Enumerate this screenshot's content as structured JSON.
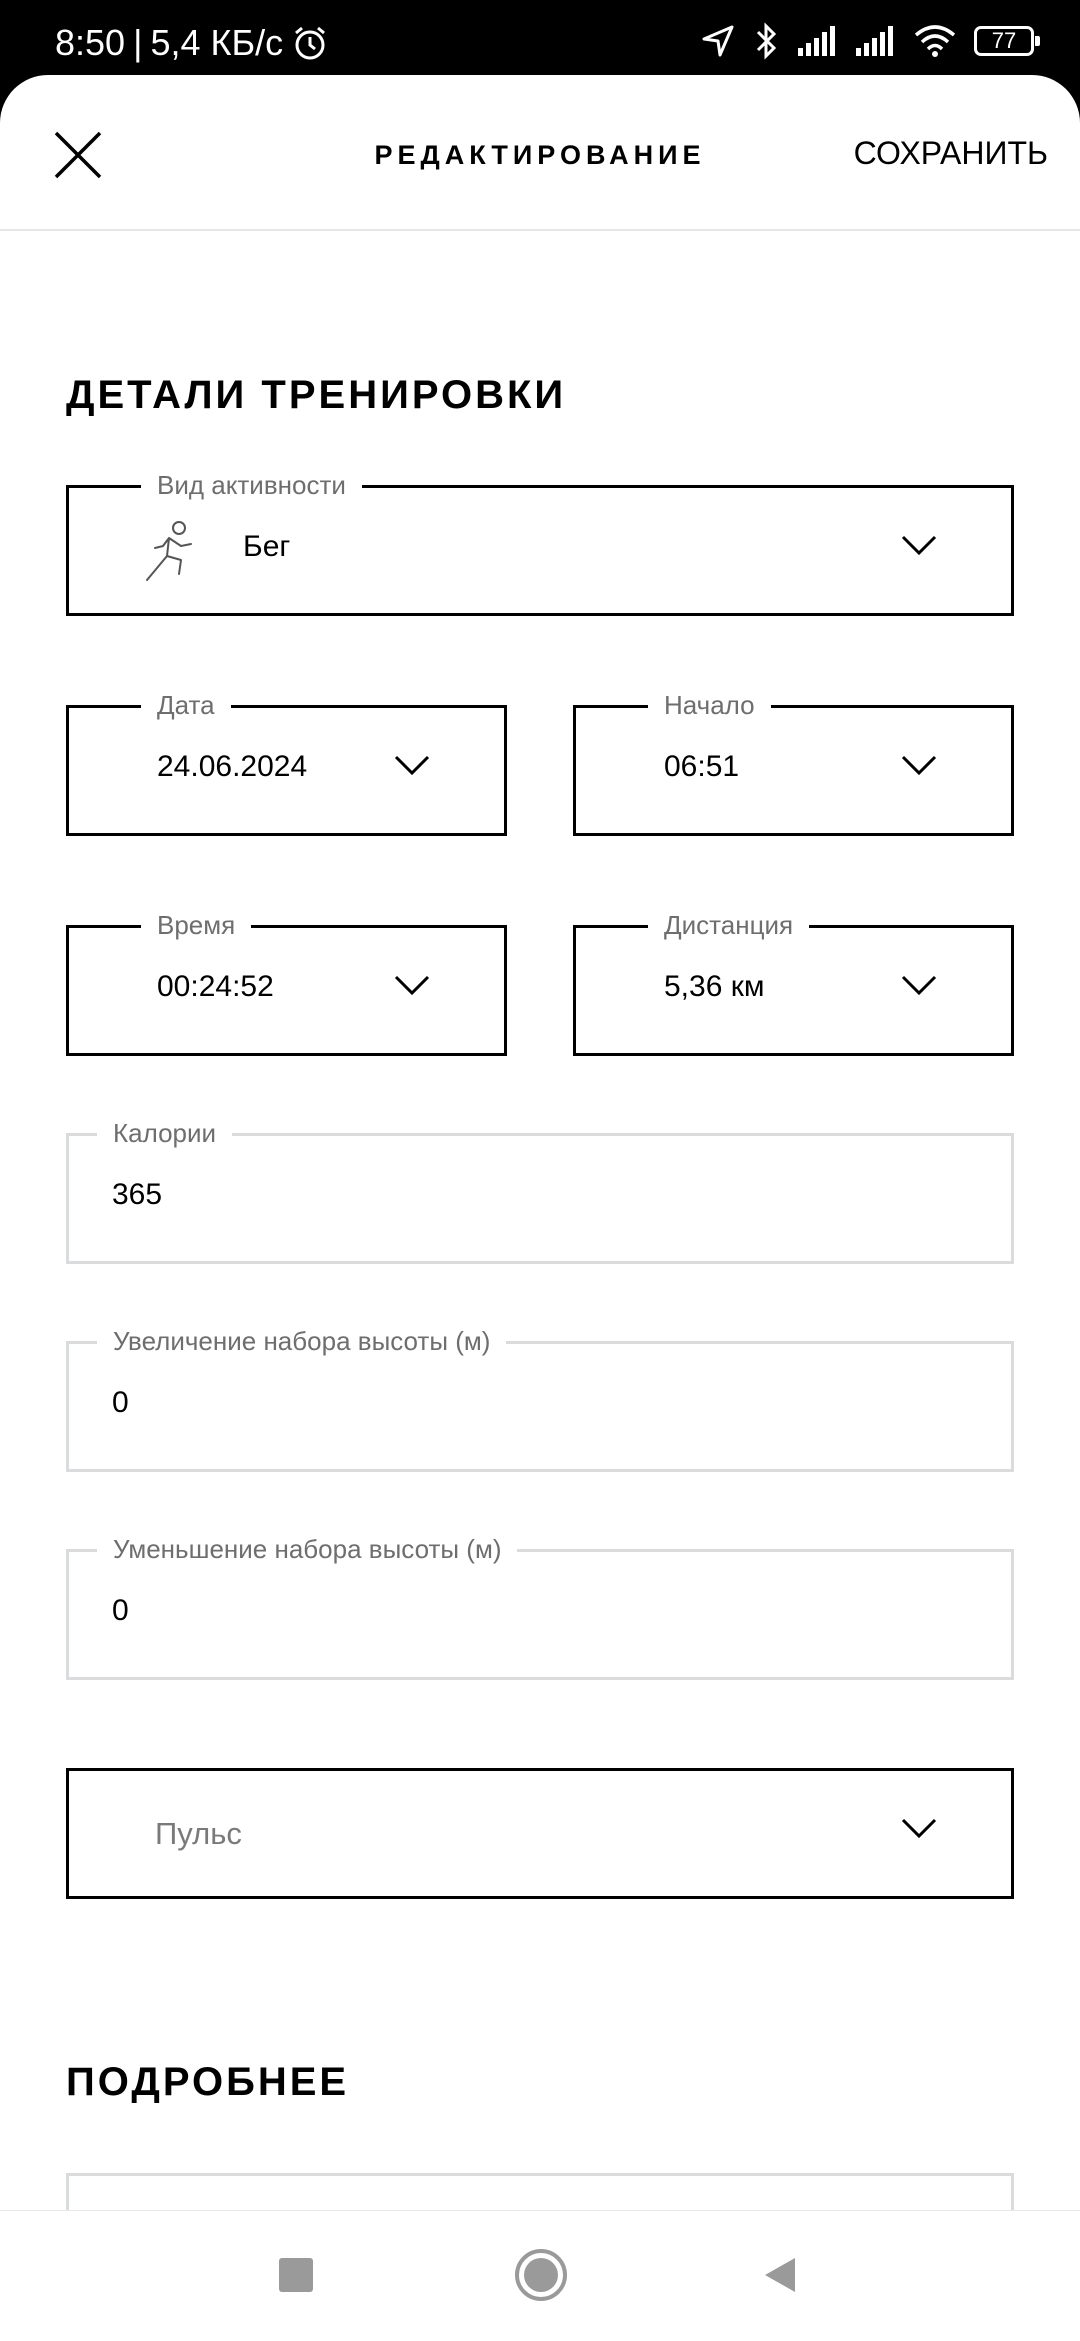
{
  "status_bar": {
    "time": "8:50",
    "separator": "|",
    "speed": "5,4 КБ/с",
    "battery": "77",
    "icons": [
      "alarm-icon",
      "location-arrow-icon",
      "bluetooth-icon",
      "signal-icon",
      "signal-icon",
      "wifi-icon",
      "battery-icon"
    ]
  },
  "header": {
    "title": "РЕДАКТИРОВАНИЕ",
    "save_label": "СОХРАНИТЬ",
    "close_icon": "close-icon"
  },
  "workout_details": {
    "section_title": "ДЕТАЛИ ТРЕНИРОВКИ",
    "activity": {
      "label": "Вид активности",
      "value": "Бег",
      "icon": "running-icon"
    },
    "date": {
      "label": "Дата",
      "value": "24.06.2024"
    },
    "start": {
      "label": "Начало",
      "value": "06:51"
    },
    "duration": {
      "label": "Время",
      "value": "00:24:52"
    },
    "distance": {
      "label": "Дистанция",
      "value": "5,36 км"
    },
    "calories": {
      "label": "Калории",
      "value": "365"
    },
    "elevation_gain": {
      "label": "Увеличение набора высоты (м)",
      "value": "0"
    },
    "elevation_loss": {
      "label": "Уменьшение набора высоты (м)",
      "value": "0"
    },
    "pulse": {
      "placeholder": "Пульс"
    }
  },
  "more": {
    "section_title": "ПОДРОБНЕЕ"
  },
  "nav_bar": {
    "icons": [
      "recent-apps-icon",
      "home-icon",
      "back-icon"
    ]
  },
  "colors": {
    "border_active": "#000000",
    "border_light": "#d9dcdc",
    "label_gray": "#6e6e6e"
  }
}
